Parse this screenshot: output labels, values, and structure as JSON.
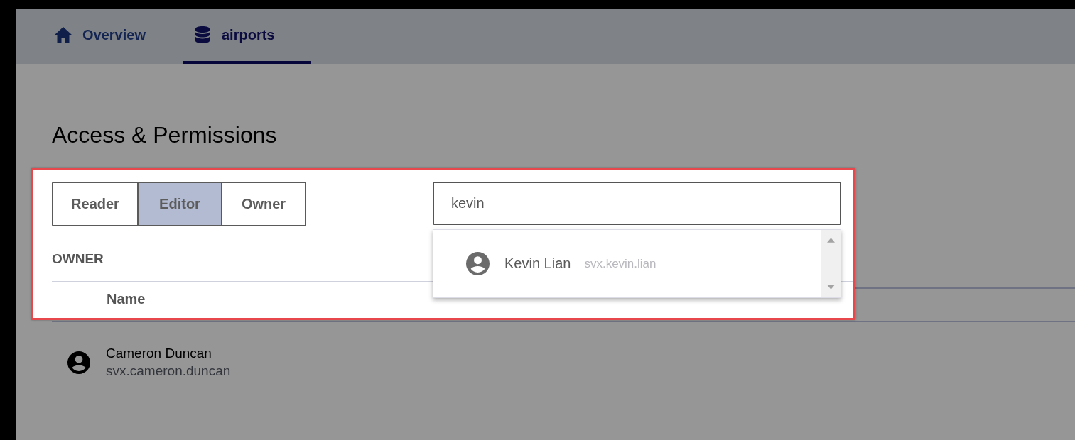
{
  "tabs": [
    {
      "label": "Overview",
      "selected": false
    },
    {
      "label": "airports",
      "selected": true
    }
  ],
  "heading": "Access & Permissions",
  "roles": [
    {
      "label": "Reader",
      "selected": false
    },
    {
      "label": "Editor",
      "selected": true
    },
    {
      "label": "Owner",
      "selected": false
    }
  ],
  "search": {
    "value": "kevin"
  },
  "suggestions": [
    {
      "name": "Kevin Lian",
      "username": "svx.kevin.lian"
    }
  ],
  "section_label": "OWNER",
  "table": {
    "columns": [
      "Name"
    ],
    "rows": [
      {
        "name": "Cameron Duncan",
        "username": "svx.cameron.duncan"
      }
    ]
  }
}
